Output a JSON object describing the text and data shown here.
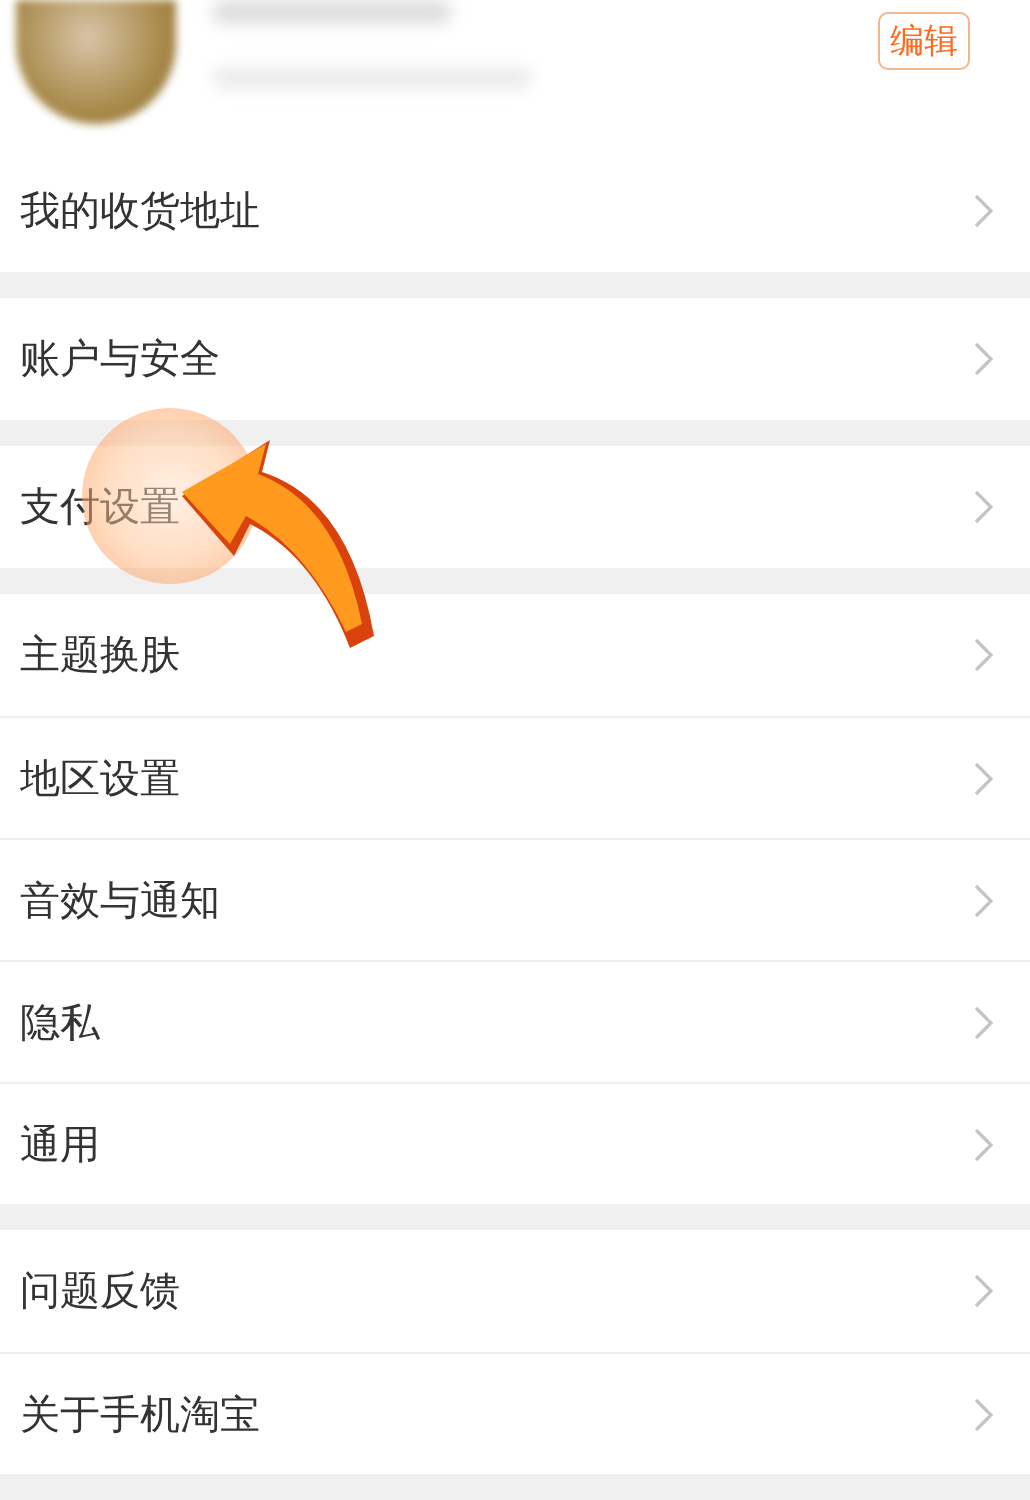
{
  "profile": {
    "edit_button": "编辑"
  },
  "groups": [
    {
      "items": [
        {
          "label": "我的收货地址"
        }
      ]
    },
    {
      "items": [
        {
          "label": "账户与安全"
        }
      ]
    },
    {
      "items": [
        {
          "label": "支付设置"
        }
      ]
    },
    {
      "items": [
        {
          "label": "主题换肤"
        },
        {
          "label": "地区设置"
        },
        {
          "label": "音效与通知"
        },
        {
          "label": "隐私"
        },
        {
          "label": "通用"
        }
      ]
    },
    {
      "items": [
        {
          "label": "问题反馈"
        },
        {
          "label": "关于手机淘宝"
        }
      ]
    }
  ]
}
